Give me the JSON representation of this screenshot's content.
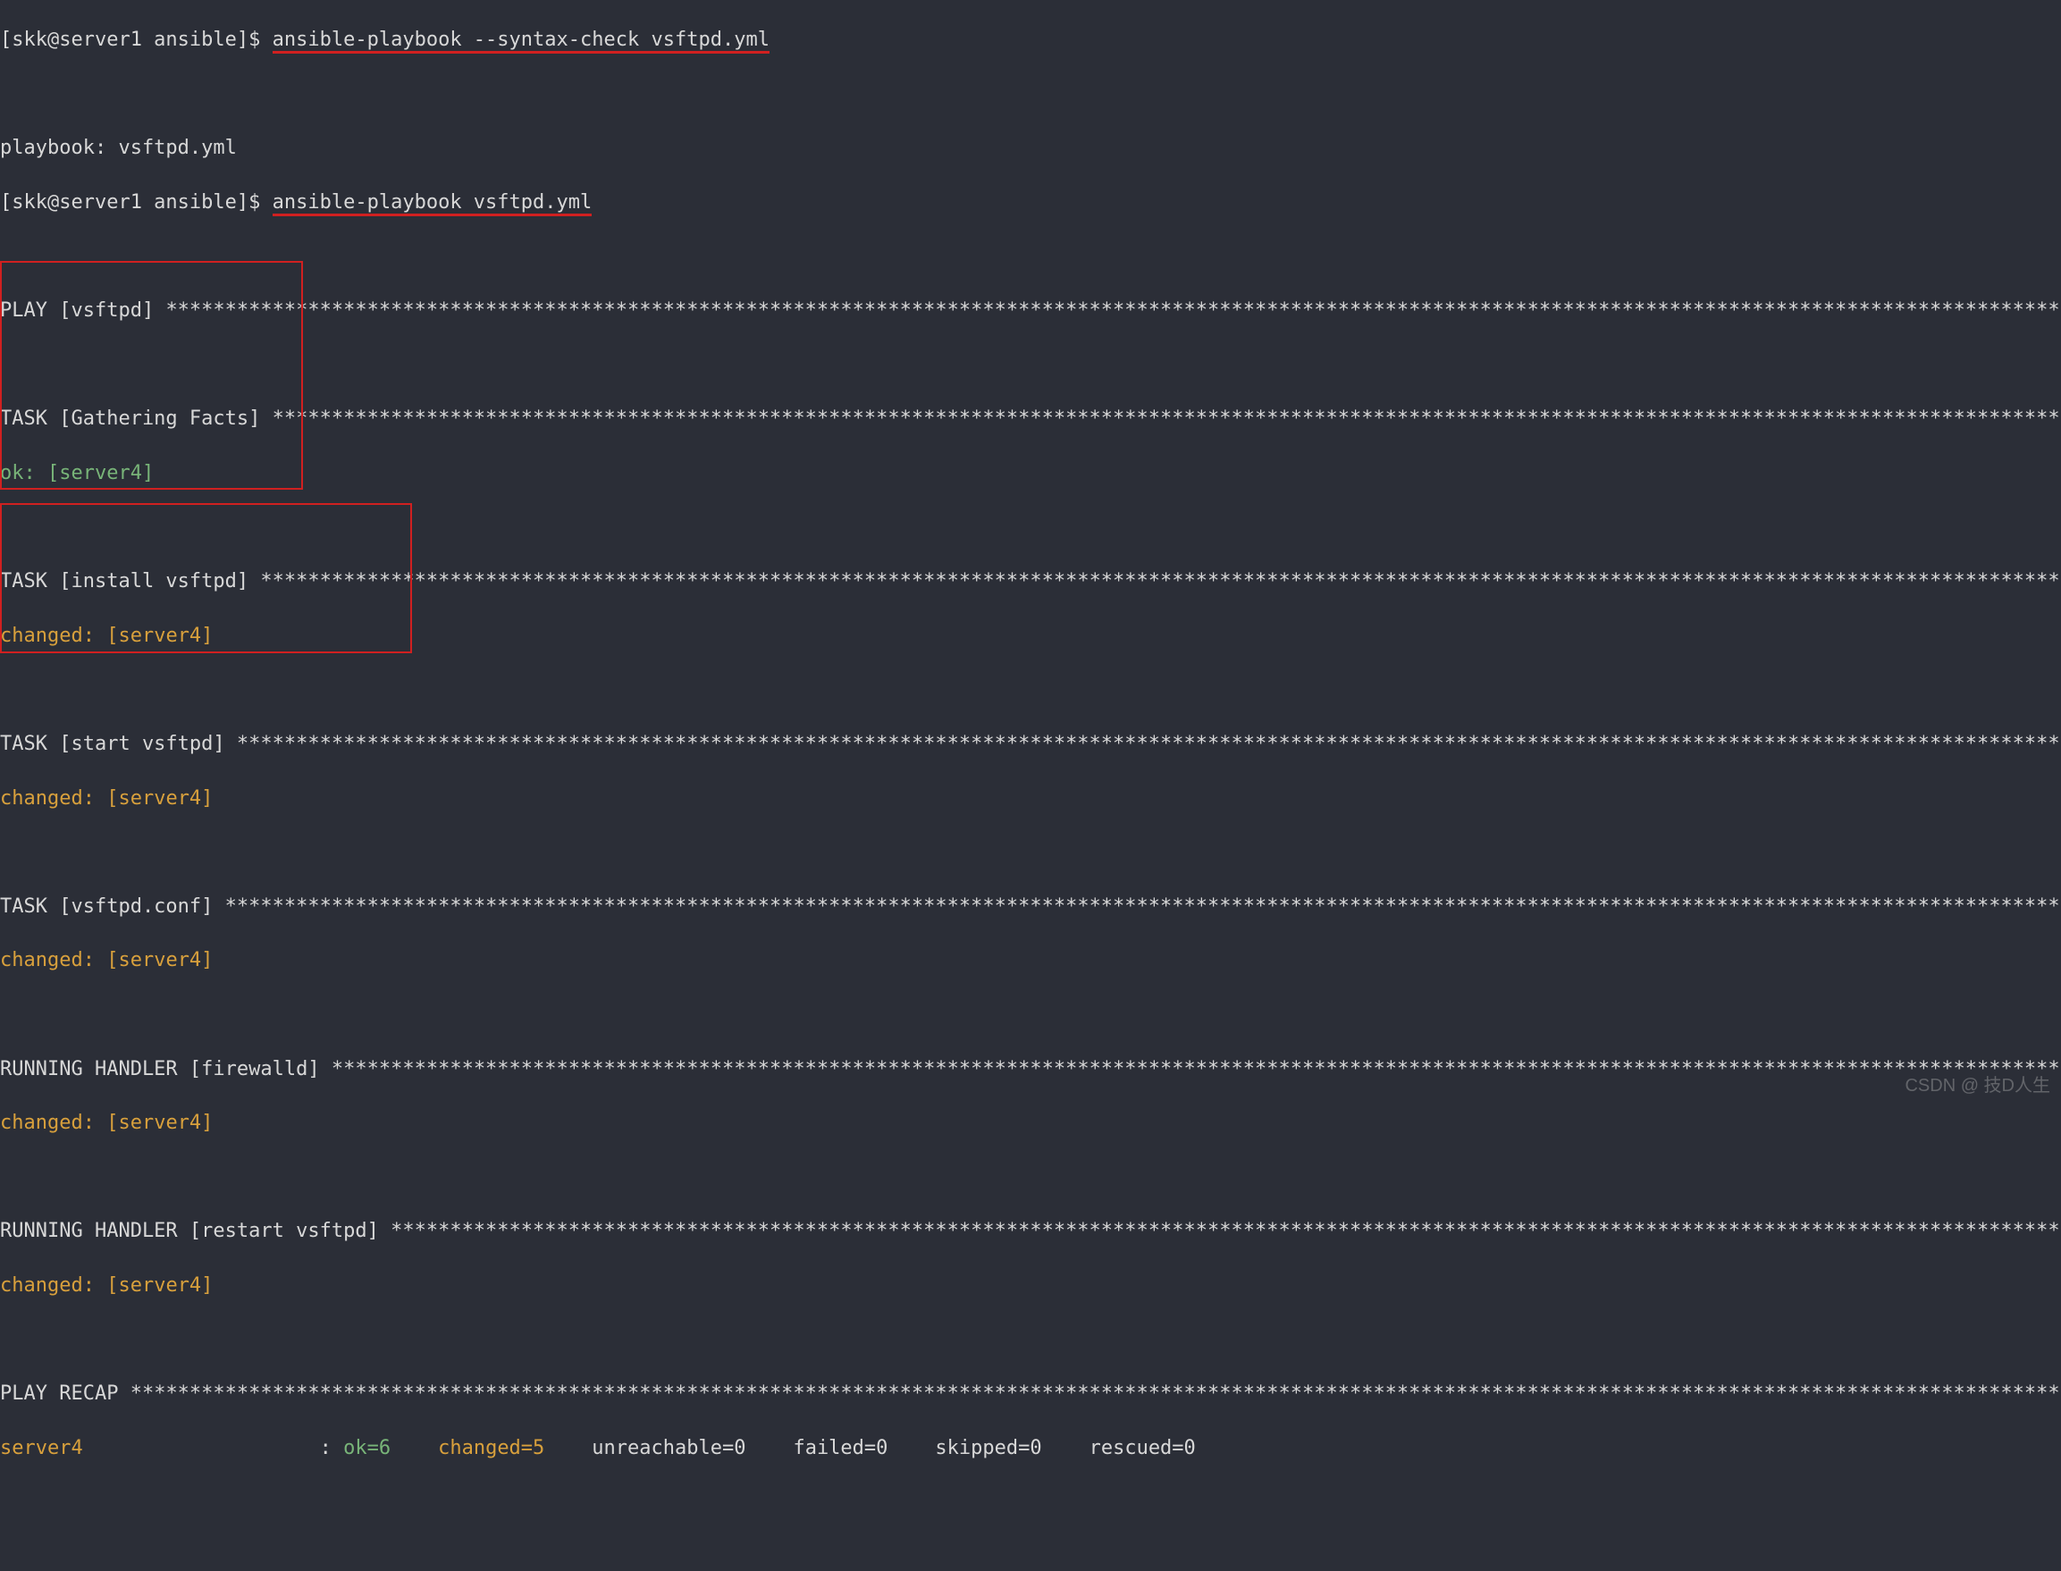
{
  "lines": {
    "prompt_user": "[skk@server1 ansible]$ ",
    "cmd_syntax": "ansible-playbook --syntax-check vsftpd.yml",
    "empty": "",
    "playbook_line": "playbook: vsftpd.yml",
    "cmd_run": "ansible-playbook vsftpd.yml",
    "play_header_prefix": "PLAY [vsftpd] ",
    "task_gather_prefix": "TASK [Gathering Facts] ",
    "ok_server4_label": "ok: ",
    "ok_server4_host": "[server4]",
    "task_install_prefix": "TASK [install vsftpd] ",
    "changed_label": "changed: ",
    "changed_host": "[server4]",
    "task_start_prefix": "TASK [start vsftpd] ",
    "task_conf_prefix": "TASK [vsftpd.conf] ",
    "handler_fw_prefix": "RUNNING HANDLER [firewalld] ",
    "handler_restart_prefix": "RUNNING HANDLER [restart vsftpd] ",
    "recap_prefix": "PLAY RECAP ",
    "recap_host": "server4",
    "recap_pad": "                    : ",
    "recap_ok": "ok=6   ",
    "recap_changed": " changed=5   ",
    "recap_unreach": " unreachable=0   ",
    "recap_failed": " failed=0   ",
    "recap_skipped": " skipped=0   ",
    "recap_rescued": " rescued=0   "
  },
  "stars": {
    "play": "*********************************************************************************************************************************************************************",
    "gather": "*****************************************************************************************************************************************************************",
    "install": "***********************************************************************************************************************************************************",
    "start": "*************************************************************************************************************************************************************",
    "conf": "**************************************************************************************************************************************************************",
    "fw": "*******************************************************************************************************************************************************",
    "restart": "**************************************************************************************************************************************************",
    "recap": "*************************************************************************************************************************************************************************"
  },
  "watermark": "CSDN @ 技D人生"
}
